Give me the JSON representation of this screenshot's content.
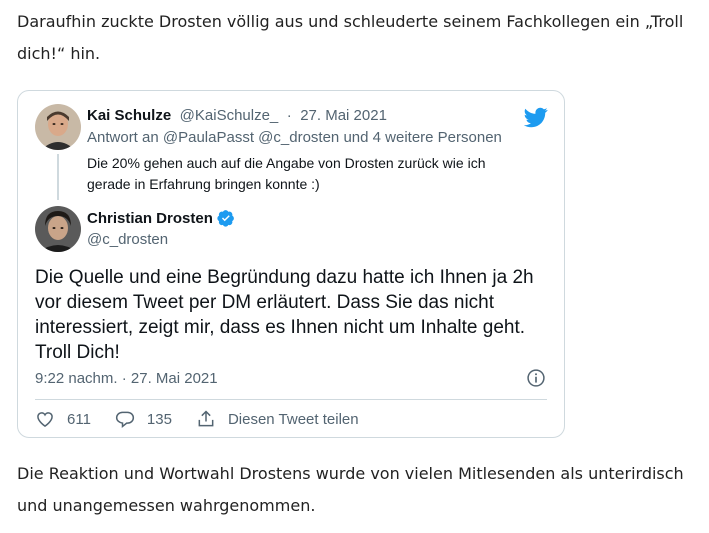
{
  "article": {
    "paragraph_top": "Daraufhin zuckte Drosten völlig aus und schleuderte seinem Fachkollegen ein „Troll dich!“ hin.",
    "paragraph_bottom": "Die Reaktion und Wortwahl Drostens wurde von vielen Mitlesenden als unterirdisch und unangemessen wahrgenommen."
  },
  "tweet": {
    "parent": {
      "author_name": "Kai Schulze",
      "handle": "@KaiSchulze_",
      "separator": "·",
      "date": "27. Mai 2021",
      "reply_prefix": "Antwort an",
      "reply_mentions": "@PaulaPasst @c_drosten",
      "reply_suffix": "und 4 weitere Personen",
      "text": "Die 20% gehen auch auf die Angabe von Drosten zurück wie ich gerade in Erfahrung bringen konnte :)"
    },
    "main": {
      "author_name": "Christian Drosten",
      "handle": "@c_drosten",
      "text": "Die Quelle und eine Begründung dazu hatte ich Ihnen ja 2h vor diesem Tweet per DM erläutert. Dass Sie das nicht interessiert, zeigt mir, dass es Ihnen nicht um Inhalte geht. Troll Dich!",
      "timestamp": "9:22 nachm. · 27. Mai 2021"
    },
    "actions": {
      "likes": "611",
      "replies": "135",
      "share_label": "Diesen Tweet teilen"
    },
    "icons": {
      "brand": "twitter-bird-icon",
      "verified": "verified-badge-icon",
      "info": "info-icon",
      "like": "heart-icon",
      "reply": "speech-bubble-icon",
      "share": "share-icon"
    },
    "colors": {
      "twitter_blue": "#1d9bf0",
      "border": "#cfd9de",
      "muted_text": "#536471",
      "primary_text": "#0f1419"
    }
  }
}
